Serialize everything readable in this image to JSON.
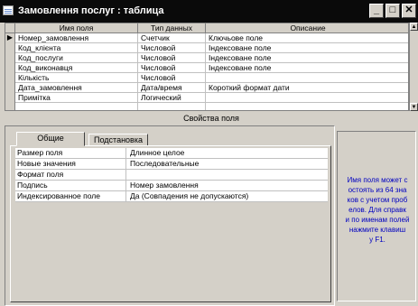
{
  "window": {
    "title": "Замовлення послуг : таблица"
  },
  "grid": {
    "columns": [
      "Имя поля",
      "Тип данных",
      "Описание"
    ],
    "rows": [
      {
        "key": true,
        "name": "Номер_замовлення",
        "type": "Счетчик",
        "desc": "Ключьове поле"
      },
      {
        "key": false,
        "name": "Код_клієнта",
        "type": "Числовой",
        "desc": "Індексоване поле"
      },
      {
        "key": false,
        "name": "Код_послуги",
        "type": "Числовой",
        "desc": "Індексоване поле"
      },
      {
        "key": false,
        "name": "Код_виконавця",
        "type": "Числовой",
        "desc": "Індексоване поле"
      },
      {
        "key": false,
        "name": "Кількість",
        "type": "Числовой",
        "desc": ""
      },
      {
        "key": false,
        "name": "Дата_замовлення",
        "type": "Дата/время",
        "desc": "Короткий формат дати"
      },
      {
        "key": false,
        "name": "Примітка",
        "type": "Логический",
        "desc": ""
      }
    ]
  },
  "properties": {
    "header": "Свойства поля",
    "tabs": [
      "Общие",
      "Подстановка"
    ],
    "items": [
      {
        "name": "Размер поля",
        "value": "Длинное целое"
      },
      {
        "name": "Новые значения",
        "value": "Последовательные"
      },
      {
        "name": "Формат поля",
        "value": ""
      },
      {
        "name": "Подпись",
        "value": "Номер замовлення"
      },
      {
        "name": "Индексированное поле",
        "value": "Да (Совпадения не допускаются)"
      }
    ]
  },
  "help": {
    "text": "Имя поля может с\nостоять из 64 зна\nков с учетом проб\nелов.  Для справк\nи по именам полей\nнажмите клавиш\nу F1."
  },
  "colors": {
    "help_text": "#0000c0",
    "title_bar": "#0a0a0a",
    "face": "#d4d0c8"
  }
}
